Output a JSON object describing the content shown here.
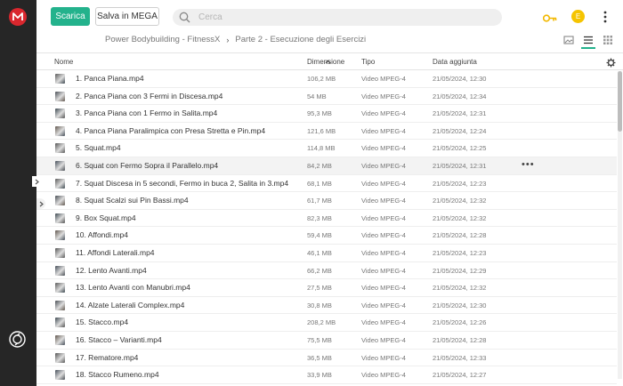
{
  "toolbar": {
    "download_label": "Scarica",
    "save_label": "Salva in MEGA"
  },
  "search": {
    "placeholder": "Cerca"
  },
  "account": {
    "avatar_letter": "E",
    "avatar_color": "#f5c400"
  },
  "brand": {
    "logo_letter": "M",
    "logo_color": "#d9272e",
    "accent": "#23b28c"
  },
  "breadcrumb": {
    "parent": "Power Bodybuilding - FitnessX",
    "current": "Parte 2 - Esecuzione degli Esercizi"
  },
  "table": {
    "headers": {
      "name": "Nome",
      "size": "Dimensione",
      "type": "Tipo",
      "date": "Data aggiunta"
    },
    "rows": [
      {
        "name": "1. Panca Piana.mp4",
        "size": "106,2 MB",
        "type": "Video MPEG-4",
        "date": "21/05/2024, 12:30"
      },
      {
        "name": "2. Panca Piana con 3 Fermi in Discesa.mp4",
        "size": "54 MB",
        "type": "Video MPEG-4",
        "date": "21/05/2024, 12:34"
      },
      {
        "name": "3. Panca Piana con 1 Fermo in Salita.mp4",
        "size": "95,3 MB",
        "type": "Video MPEG-4",
        "date": "21/05/2024, 12:31"
      },
      {
        "name": "4. Panca Piana Paralimpica con Presa Stretta e Pin.mp4",
        "size": "121,6 MB",
        "type": "Video MPEG-4",
        "date": "21/05/2024, 12:24"
      },
      {
        "name": "5. Squat.mp4",
        "size": "114,8 MB",
        "type": "Video MPEG-4",
        "date": "21/05/2024, 12:25"
      },
      {
        "name": "6. Squat con Fermo Sopra il Parallelo.mp4",
        "size": "84,2 MB",
        "type": "Video MPEG-4",
        "date": "21/05/2024, 12:31",
        "more": "•••"
      },
      {
        "name": "7. Squat Discesa in 5 secondi, Fermo in buca 2, Salita in 3.mp4",
        "size": "68,1 MB",
        "type": "Video MPEG-4",
        "date": "21/05/2024, 12:23"
      },
      {
        "name": "8. Squat Scalzi sui Pin Bassi.mp4",
        "size": "61,7 MB",
        "type": "Video MPEG-4",
        "date": "21/05/2024, 12:32"
      },
      {
        "name": "9. Box Squat.mp4",
        "size": "82,3 MB",
        "type": "Video MPEG-4",
        "date": "21/05/2024, 12:32"
      },
      {
        "name": "10. Affondi.mp4",
        "size": "59,4 MB",
        "type": "Video MPEG-4",
        "date": "21/05/2024, 12:28"
      },
      {
        "name": "11. Affondi Laterali.mp4",
        "size": "46,1 MB",
        "type": "Video MPEG-4",
        "date": "21/05/2024, 12:23"
      },
      {
        "name": "12. Lento Avanti.mp4",
        "size": "66,2 MB",
        "type": "Video MPEG-4",
        "date": "21/05/2024, 12:29"
      },
      {
        "name": "13. Lento Avanti con Manubri.mp4",
        "size": "27,5 MB",
        "type": "Video MPEG-4",
        "date": "21/05/2024, 12:32"
      },
      {
        "name": "14. Alzate Laterali Complex.mp4",
        "size": "30,8 MB",
        "type": "Video MPEG-4",
        "date": "21/05/2024, 12:30"
      },
      {
        "name": "15. Stacco.mp4",
        "size": "208,2 MB",
        "type": "Video MPEG-4",
        "date": "21/05/2024, 12:26"
      },
      {
        "name": "16. Stacco – Varianti.mp4",
        "size": "75,5 MB",
        "type": "Video MPEG-4",
        "date": "21/05/2024, 12:28"
      },
      {
        "name": "17. Rematore.mp4",
        "size": "36,5 MB",
        "type": "Video MPEG-4",
        "date": "21/05/2024, 12:33"
      },
      {
        "name": "18. Stacco Rumeno.mp4",
        "size": "33,9 MB",
        "type": "Video MPEG-4",
        "date": "21/05/2024, 12:27"
      }
    ]
  },
  "icons": {
    "logo": "mega-logo-icon",
    "search": "search-icon",
    "key": "key-icon",
    "menu": "kebab-menu-icon",
    "view_thumb": "thumbnail-view-icon",
    "view_list": "list-view-icon",
    "view_grid": "grid-view-icon",
    "settings": "gear-icon",
    "sync": "sync-icon",
    "sort": "sort-up-icon",
    "thumb": "video-thumbnail"
  }
}
